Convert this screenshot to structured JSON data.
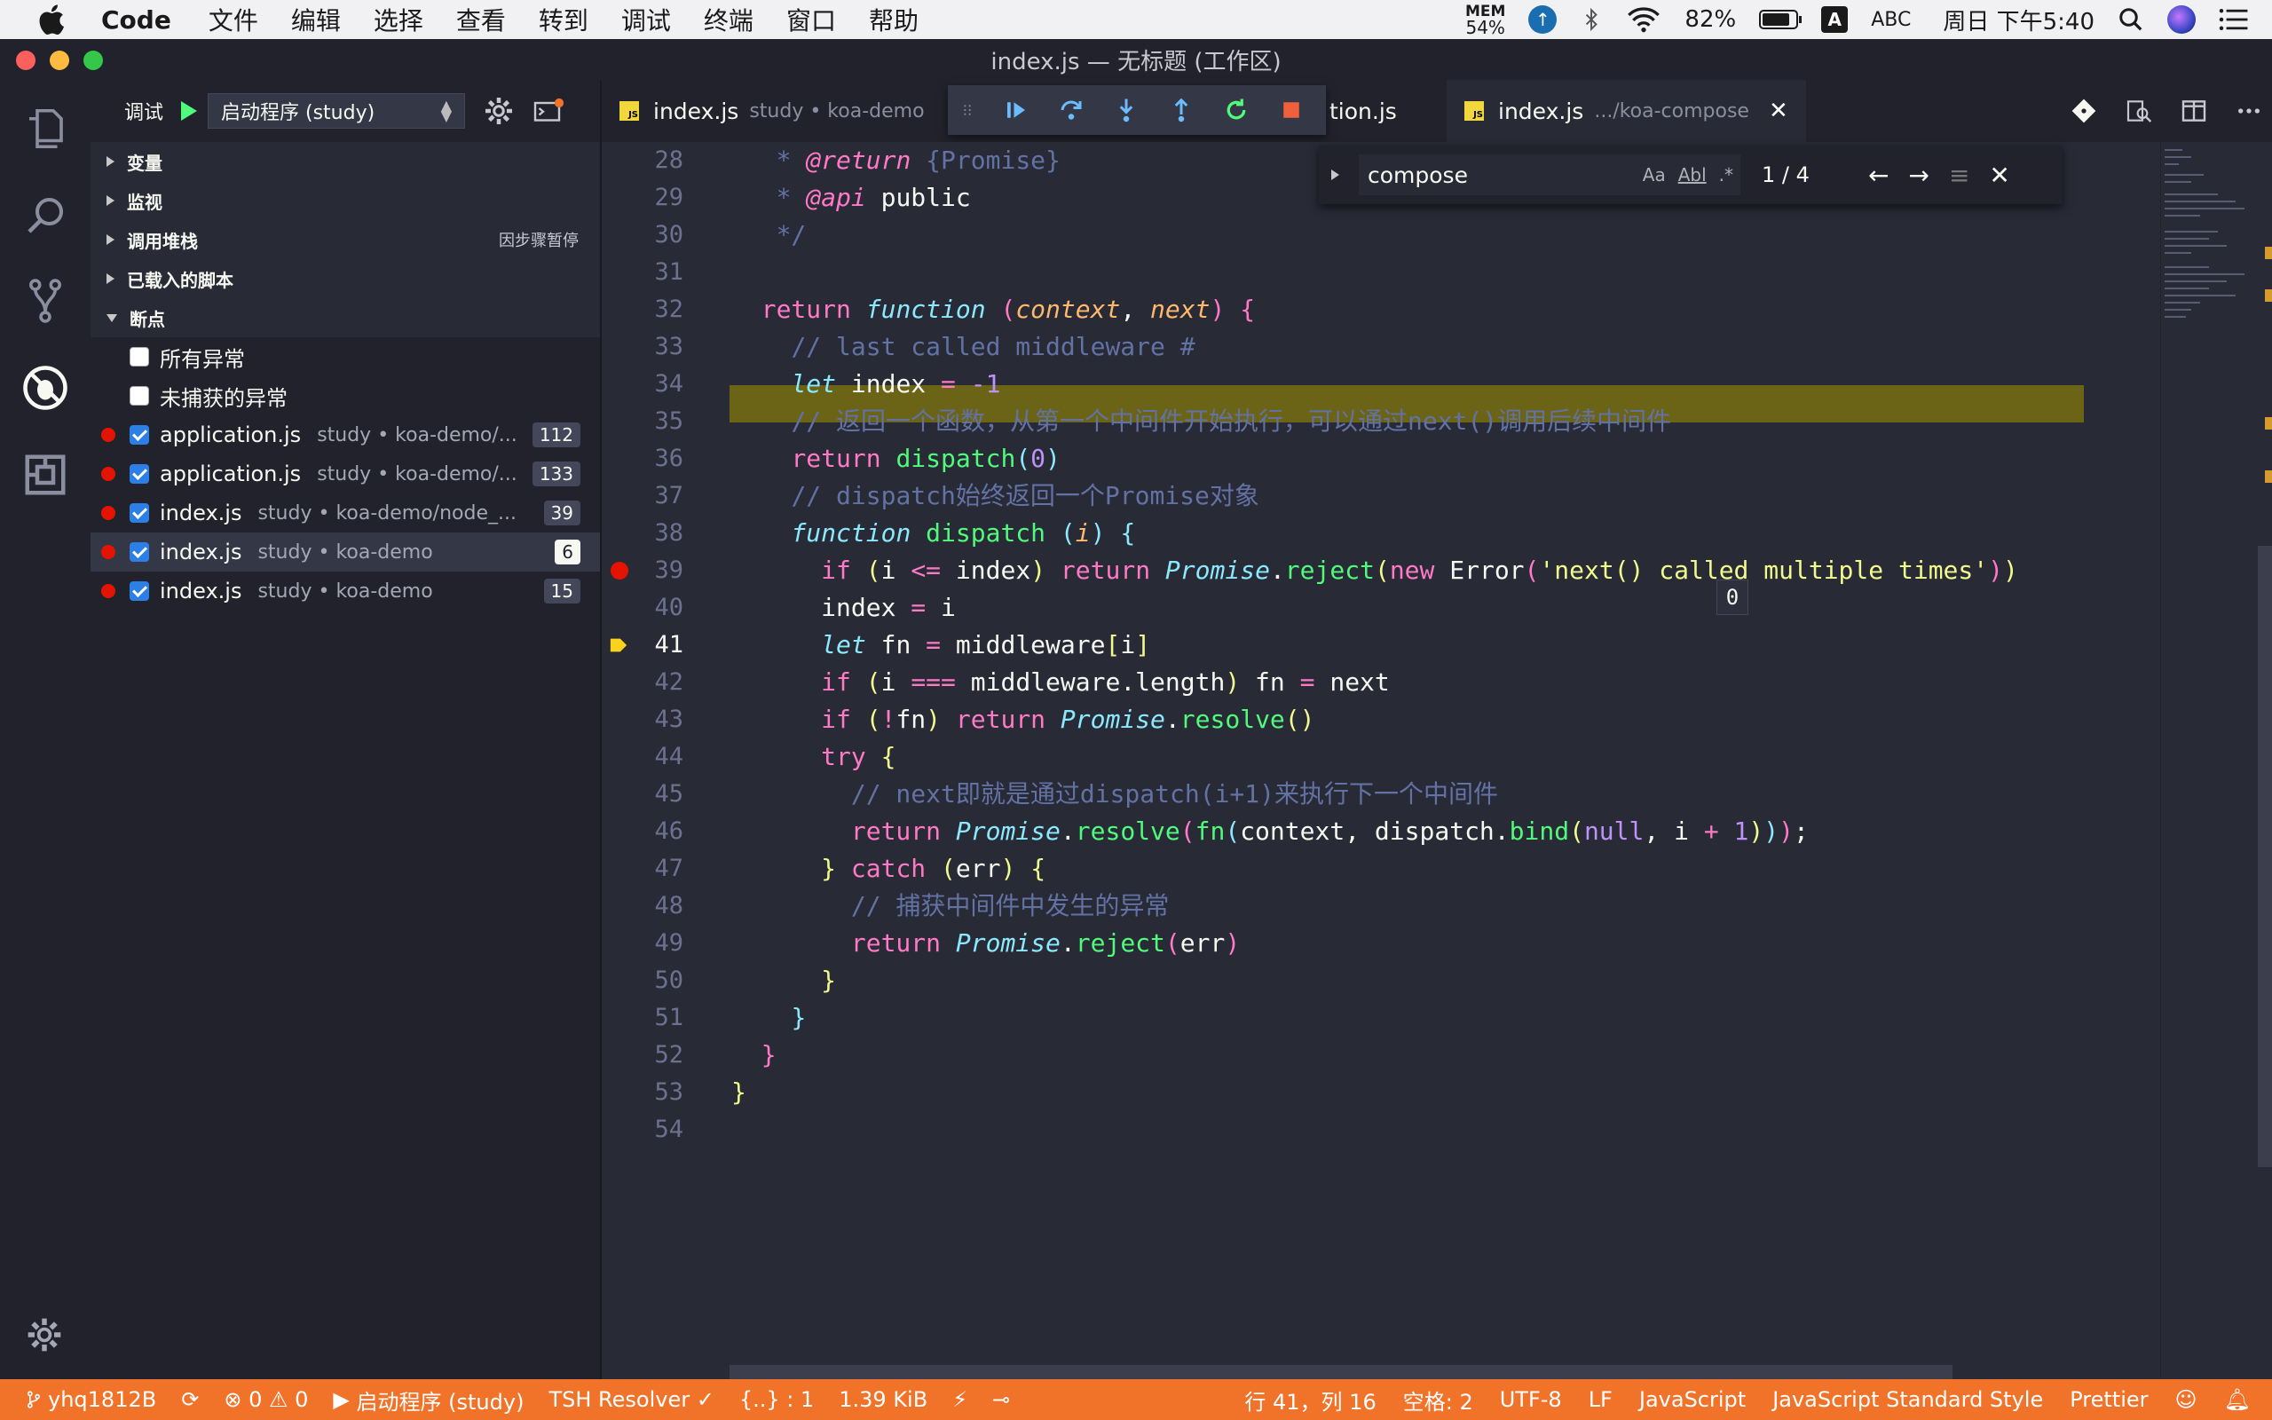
{
  "menubar": {
    "app": "Code",
    "items": [
      "文件",
      "编辑",
      "选择",
      "查看",
      "转到",
      "调试",
      "终端",
      "窗口",
      "帮助"
    ],
    "mem_label": "MEM",
    "mem_value": "54%",
    "battery": "82%",
    "battery_level": 0.82,
    "ime_letter": "A",
    "ime": "ABC",
    "clock": "周日 下午5:40"
  },
  "window": {
    "title": "index.js — 无标题 (工作区)"
  },
  "debug": {
    "label": "调试",
    "config": "启动程序 (study)",
    "sections": {
      "variables": "变量",
      "watch": "监视",
      "callstack": "调用堆栈",
      "callstack_status": "因步骤暂停",
      "scripts": "已载入的脚本",
      "breakpoints": "断点"
    },
    "exceptions": [
      {
        "label": "所有异常",
        "checked": false
      },
      {
        "label": "未捕获的异常",
        "checked": false
      }
    ],
    "breakpoints": [
      {
        "file": "application.js",
        "path": "study • koa-demo/...",
        "line": "112"
      },
      {
        "file": "application.js",
        "path": "study • koa-demo/...",
        "line": "133"
      },
      {
        "file": "index.js",
        "path": "study • koa-demo/node_...",
        "line": "39"
      },
      {
        "file": "index.js",
        "path": "study • koa-demo",
        "line": "6"
      },
      {
        "file": "index.js",
        "path": "study • koa-demo",
        "line": "15"
      }
    ]
  },
  "tabs": [
    {
      "file": "index.js",
      "desc": "study • koa-demo"
    },
    {
      "file": "tion.js",
      "desc": ""
    },
    {
      "file": "index.js",
      "desc": ".../koa-compose",
      "close": "✕"
    }
  ],
  "find": {
    "query": "compose",
    "opt_case": "Aa",
    "opt_word": "Abl",
    "opt_regex": ".*",
    "count": "1 / 4"
  },
  "hover_value": "0",
  "editor": {
    "line_numbers": [
      "28",
      "29",
      "30",
      "31",
      "32",
      "33",
      "34",
      "35",
      "36",
      "37",
      "38",
      "39",
      "40",
      "41",
      "42",
      "43",
      "44",
      "45",
      "46",
      "47",
      "48",
      "49",
      "50",
      "51",
      "52",
      "53",
      "54"
    ],
    "current_line": "41",
    "breakpoint_line": "39"
  },
  "statusbar": {
    "branch": "yhq1812B",
    "errors": "0",
    "warnings": "0",
    "debug": "启动程序 (study)",
    "tsh": "TSH Resolver ✓",
    "braces": "{..} : 1",
    "size": "1.39 KiB",
    "position": "行 41，列 16",
    "spaces": "空格: 2",
    "encoding": "UTF-8",
    "eol": "LF",
    "language": "JavaScript",
    "style": "JavaScript Standard Style",
    "formatter": "Prettier"
  },
  "icons": [
    "apple-icon",
    "explorer-icon",
    "search-icon",
    "git-icon",
    "debug-icon",
    "extensions-icon",
    "gear-icon",
    "play-icon",
    "continue-icon",
    "step-over-icon",
    "step-into-icon",
    "step-out-icon",
    "restart-icon",
    "stop-icon",
    "split-editor-icon",
    "more-icon",
    "bell-icon",
    "smiley-icon"
  ],
  "colors": {
    "statusbar": "#f1732a",
    "editor_bg": "#282a36",
    "sidebar_bg": "#21222c",
    "current_line": "#6b6316",
    "breakpoint": "#e51400"
  }
}
